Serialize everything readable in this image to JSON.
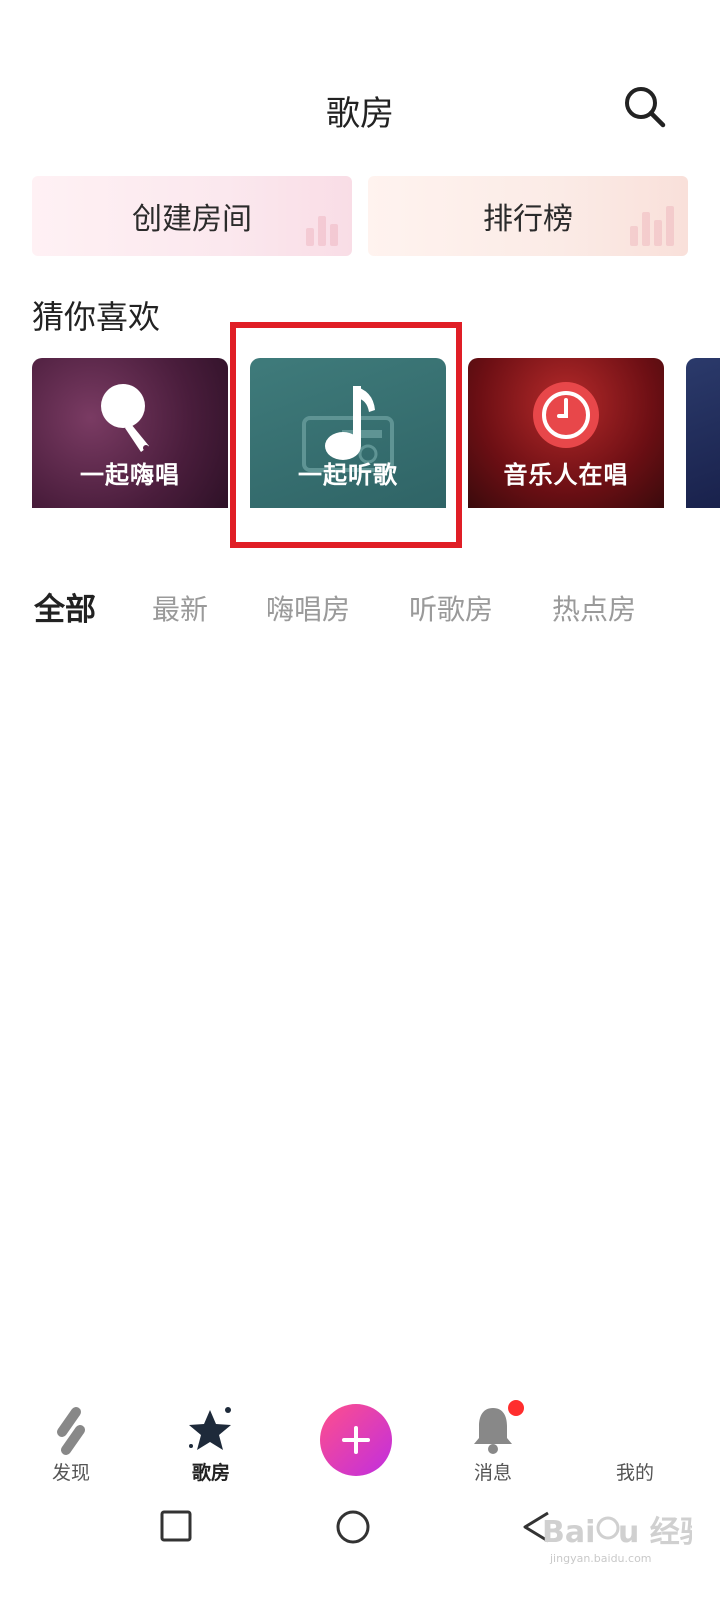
{
  "header": {
    "title": "歌房",
    "search_icon": "search-icon"
  },
  "actions": {
    "create_room": "创建房间",
    "leaderboard": "排行榜"
  },
  "recommend": {
    "title": "猜你喜欢",
    "cards": [
      {
        "label": "一起嗨唱",
        "icon": "microphone-icon"
      },
      {
        "label": "一起听歌",
        "icon": "music-note-icon"
      },
      {
        "label": "音乐人在唱",
        "icon": "vinyl-icon"
      }
    ]
  },
  "tabs": [
    {
      "label": "全部",
      "active": true
    },
    {
      "label": "最新",
      "active": false
    },
    {
      "label": "嗨唱房",
      "active": false
    },
    {
      "label": "听歌房",
      "active": false
    },
    {
      "label": "热点房",
      "active": false
    }
  ],
  "bottom_nav": {
    "discover": "发现",
    "song_room": "歌房",
    "messages": "消息",
    "mine": "我的"
  },
  "colors": {
    "highlight": "#e01e26",
    "accent": "#ff4f8b"
  }
}
